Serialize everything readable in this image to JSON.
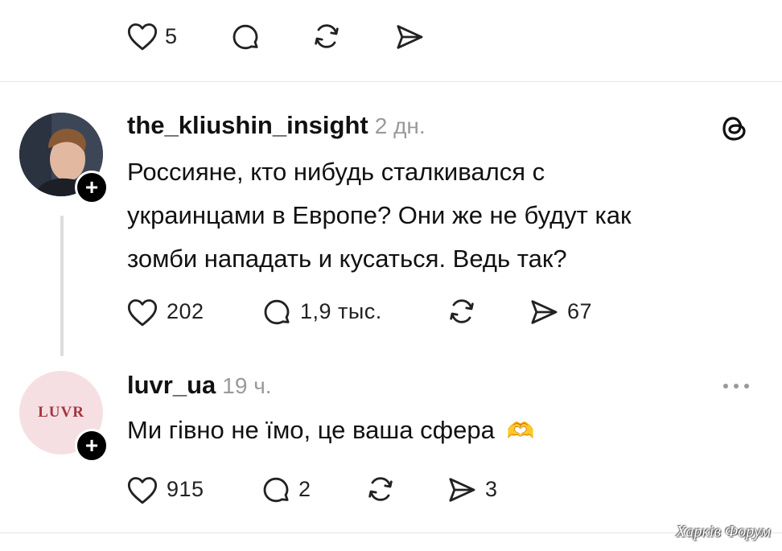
{
  "top_actions": {
    "likes": "5"
  },
  "post1": {
    "username": "the_kliushin_insight",
    "time": "2 дн.",
    "lines": [
      "Россияне, кто нибудь сталкивался с",
      "украинцами в Европе? Они же не будут как",
      "зомби нападать и кусаться. Ведь так?"
    ],
    "likes": "202",
    "replies": "1,9 тыс.",
    "shares": "67"
  },
  "post2": {
    "username": "luvr_ua",
    "time": "19 ч.",
    "avatar_text": "LUVR",
    "text": "Ми гівно не їмо, це ваша сфера",
    "emoji": "🫶",
    "likes": "915",
    "replies": "2",
    "shares": "3"
  },
  "watermark": "Харків Форум",
  "colors": {
    "text": "#111111",
    "muted": "#9a9a9a",
    "divider": "#e4e4e4",
    "luvr_bg": "#f6dfe2",
    "luvr_text": "#a3373f"
  },
  "icons": [
    "heart-icon",
    "comment-icon",
    "repost-icon",
    "send-icon",
    "threads-logo-icon",
    "more-icon",
    "follow-plus-icon"
  ]
}
